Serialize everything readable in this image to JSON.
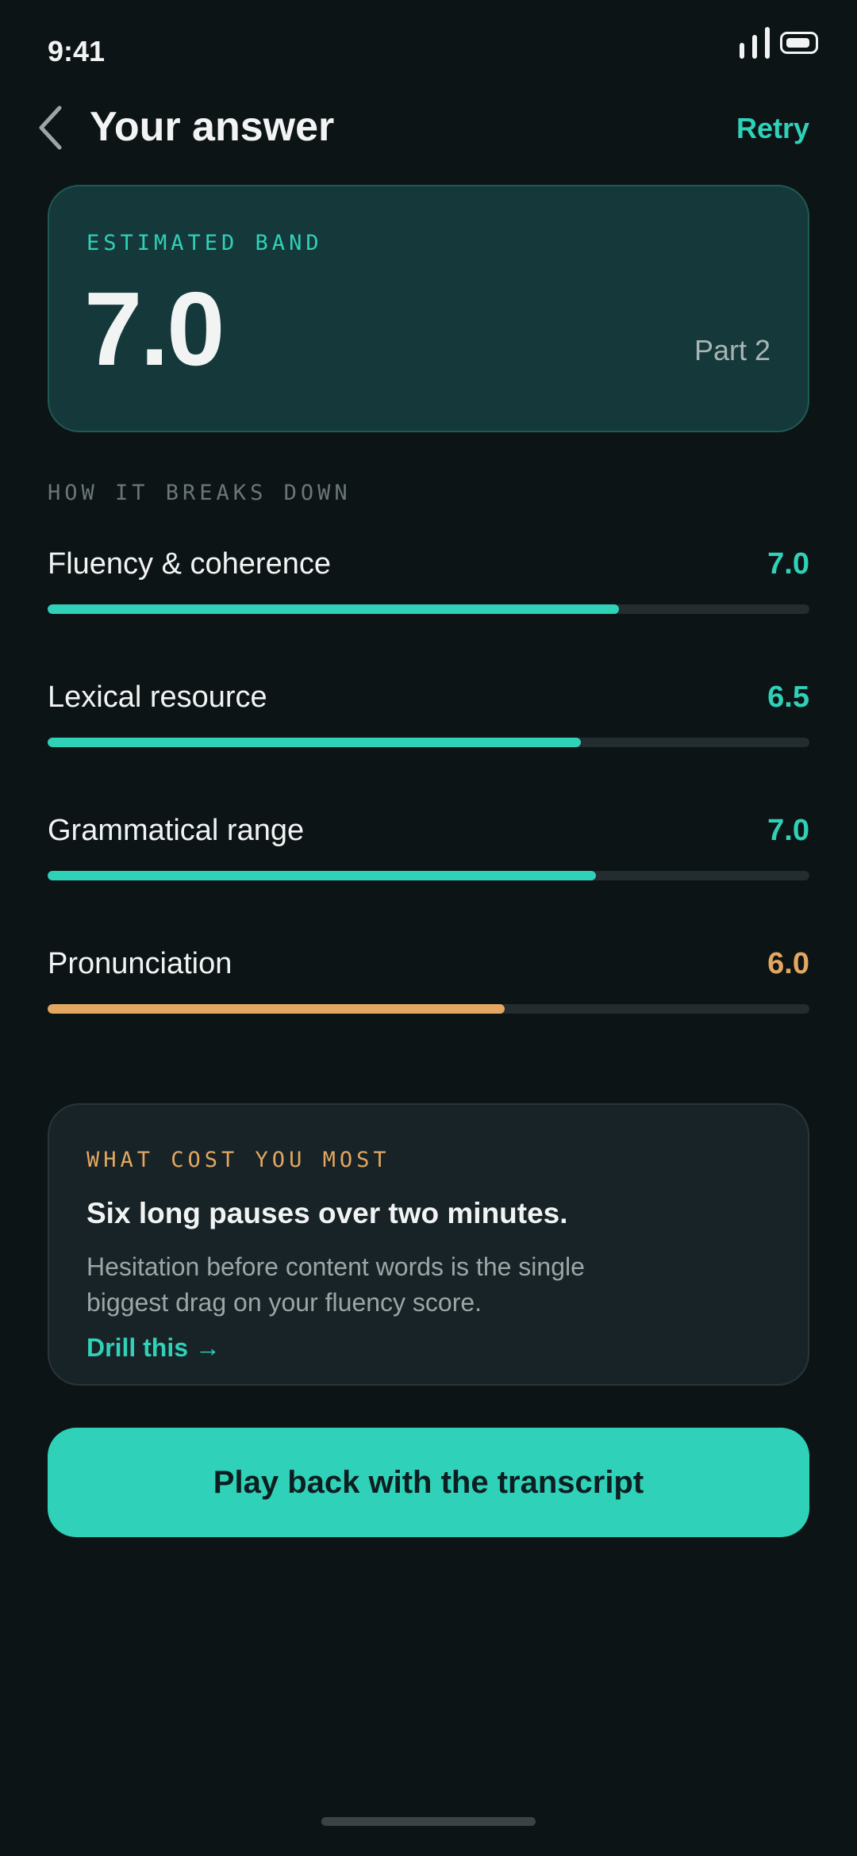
{
  "status_bar": {
    "time": "9:41"
  },
  "header": {
    "title": "Your answer",
    "retry_label": "Retry"
  },
  "band_card": {
    "label": "ESTIMATED BAND",
    "value": "7.0",
    "part": "Part 2"
  },
  "breakdown": {
    "section_label": "HOW IT BREAKS DOWN",
    "criteria": [
      {
        "name": "Fluency & coherence",
        "score": "7.0",
        "progress": 0.75
      },
      {
        "name": "Lexical resource",
        "score": "6.5",
        "progress": 0.7
      },
      {
        "name": "Grammatical range",
        "score": "7.0",
        "progress": 0.72
      },
      {
        "name": "Pronunciation",
        "score": "6.0",
        "progress": 0.6
      }
    ]
  },
  "tip_card": {
    "label": "WHAT COST YOU MOST",
    "title": "Six long pauses over two minutes.",
    "body": "Hesitation before content words is the single biggest drag on your fluency score.",
    "link_label": "Drill this →"
  },
  "primary_action": {
    "label": "Play back with the transcript"
  },
  "colors": {
    "accent": "#2fd1b8",
    "warning": "#e3a761",
    "background": "#0d1416",
    "card": "#15393a"
  }
}
